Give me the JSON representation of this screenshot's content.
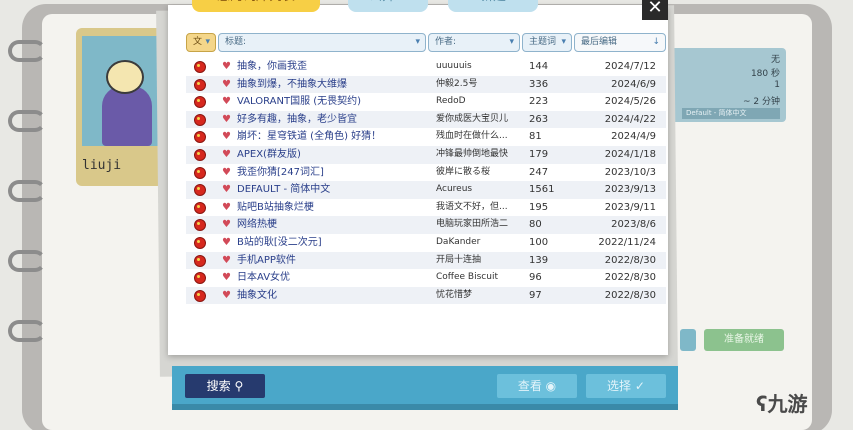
{
  "tabs": {
    "main_label": "您的词库列表",
    "public_label": "公开ᯤ",
    "new_label": "新建"
  },
  "background": {
    "player_name": "liuji",
    "panel_line1": "无",
    "panel_line2": "180 秒",
    "panel_line3": "1",
    "panel_line4": "~ 2 分钟",
    "panel_select": "Default - 简体中文",
    "ready_label": "准备就绪"
  },
  "filters": {
    "flag_label": "文",
    "title_placeholder": "标题:",
    "author_placeholder": "作者:",
    "keyword_placeholder": "主题词",
    "sort_label": "最后编辑"
  },
  "rows": [
    {
      "name": "抽象，你画我歪",
      "author": "uuuuuis",
      "count": "144",
      "date": "2024/7/12"
    },
    {
      "name": "抽象到爆，不抽象大维爆",
      "author": "仲毅2.5号",
      "count": "336",
      "date": "2024/6/9"
    },
    {
      "name": "VALORANT国服 (无畏契约)",
      "author": "RedoD",
      "count": "223",
      "date": "2024/5/26"
    },
    {
      "name": "好多有趣，抽象，老少皆宜",
      "author": "爱你成医大宝贝儿",
      "count": "263",
      "date": "2024/4/22"
    },
    {
      "name": "崩坏：星穹铁道 (全角色) 好猜！",
      "author": "残血时在做什么...",
      "count": "81",
      "date": "2024/4/9"
    },
    {
      "name": "APEX(群友版)",
      "author": "冲锋最帅倒地最快",
      "count": "179",
      "date": "2024/1/18"
    },
    {
      "name": "我歪你猜[247词汇]",
      "author": "彼岸に散る桜",
      "count": "247",
      "date": "2023/10/3"
    },
    {
      "name": "DEFAULT - 简体中文",
      "author": "Acureus",
      "count": "1561",
      "date": "2023/9/13"
    },
    {
      "name": "贴吧B站抽象烂梗",
      "author": "我语文不好，但...",
      "count": "195",
      "date": "2023/9/11"
    },
    {
      "name": "网络热梗",
      "author": "电脑玩家田所浩二",
      "count": "80",
      "date": "2023/8/6"
    },
    {
      "name": "B站的耿[没二次元]",
      "author": "DaKander",
      "count": "100",
      "date": "2022/11/24"
    },
    {
      "name": "手机APP软件",
      "author": "开局十连抽",
      "count": "139",
      "date": "2022/8/30"
    },
    {
      "name": "日本AV女优",
      "author": "Coffee Biscuit",
      "count": "96",
      "date": "2022/8/30"
    },
    {
      "name": "抽象文化",
      "author": "忧花惜梦",
      "count": "97",
      "date": "2022/8/30"
    }
  ],
  "buttons": {
    "search_label": "搜索",
    "view_label": "查看",
    "select_label": "选择"
  },
  "watermark": "九游",
  "colors": {
    "accent_yellow": "#f7cf45",
    "bar_blue": "#4aa7c9",
    "search_navy": "#263a6e",
    "flag_red": "#d6281e"
  }
}
